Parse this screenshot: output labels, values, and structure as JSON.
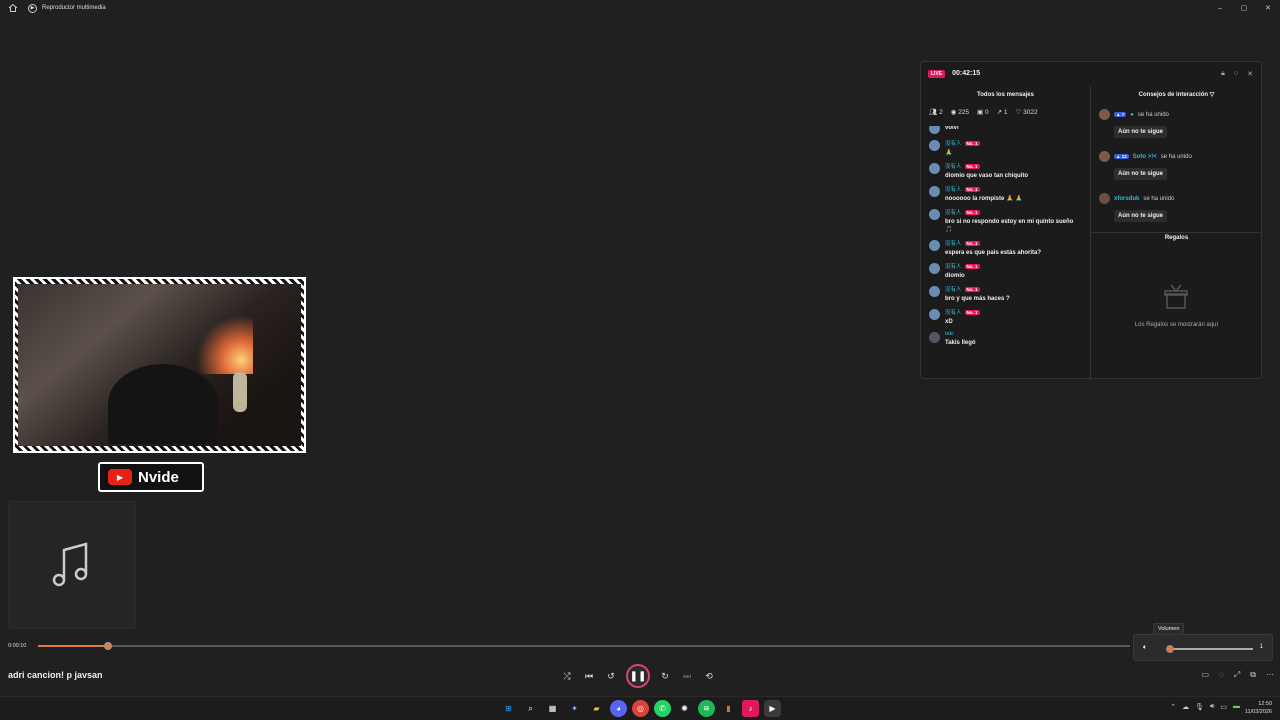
{
  "window": {
    "title": "Reproductor multimedia",
    "controls": [
      "–",
      "▢",
      "✕"
    ]
  },
  "stream_panel": {
    "live_badge": "LIVE",
    "elapsed": "00:42:15",
    "messages_title": "Todos los mensajes",
    "stats": [
      {
        "icon": "users-icon",
        "value": "2"
      },
      {
        "icon": "eye-icon",
        "value": "225"
      },
      {
        "icon": "gift-icon",
        "value": "0"
      },
      {
        "icon": "share-icon",
        "value": "1"
      },
      {
        "icon": "heart-icon",
        "value": "3022"
      }
    ],
    "messages": [
      {
        "user": "",
        "badge": "",
        "text": "volvi"
      },
      {
        "user": "没有人",
        "badge": "No. 1",
        "text": "🙏"
      },
      {
        "user": "没有人",
        "badge": "No. 1",
        "text": "diomio que vaso tan chiquito"
      },
      {
        "user": "没有人",
        "badge": "No. 1",
        "text": "noooooo la rompiste 🙏 🙏"
      },
      {
        "user": "没有人",
        "badge": "No. 1",
        "text": "bro si no respondo estoy en mi quinto sueño 🎵"
      },
      {
        "user": "没有人",
        "badge": "No. 1",
        "text": "espera es que pais estás ahorita?"
      },
      {
        "user": "没有人",
        "badge": "No. 1",
        "text": "diomio"
      },
      {
        "user": "没有人",
        "badge": "No. 1",
        "text": "bro y que más haces ?"
      },
      {
        "user": "没有人",
        "badge": "No. 1",
        "text": "xD"
      },
      {
        "user": "taki",
        "badge": "",
        "text": "Takis llegó"
      }
    ],
    "tips_title": "Consejos de interacción",
    "tips": [
      {
        "level": "7",
        "name": "",
        "action": "se ha unido",
        "button": "Aún no te sigue"
      },
      {
        "level": "12",
        "name": "Soto >!<",
        "action": "se ha unido",
        "button": "Aún no te sigue"
      },
      {
        "level": "",
        "name": "xforsduk",
        "action": "se ha unido",
        "button": "Aún no te sigue"
      }
    ],
    "gifts_title": "Regalos",
    "gifts_empty": "Los Regalos se mostrarán aquí"
  },
  "overlay": {
    "channel_name": "Nvide"
  },
  "player": {
    "position": "0:00:10",
    "progress": 0.064,
    "now_playing": "adri cancion! p javsan",
    "volume_tooltip": "Volumen",
    "volume_value": "1",
    "volume_level": 0.01
  },
  "clock": {
    "time": "12:50",
    "date": "11/03/2026"
  },
  "colors": {
    "accent": "#e07b45",
    "live": "#e0195a",
    "username": "#37b8d4"
  }
}
